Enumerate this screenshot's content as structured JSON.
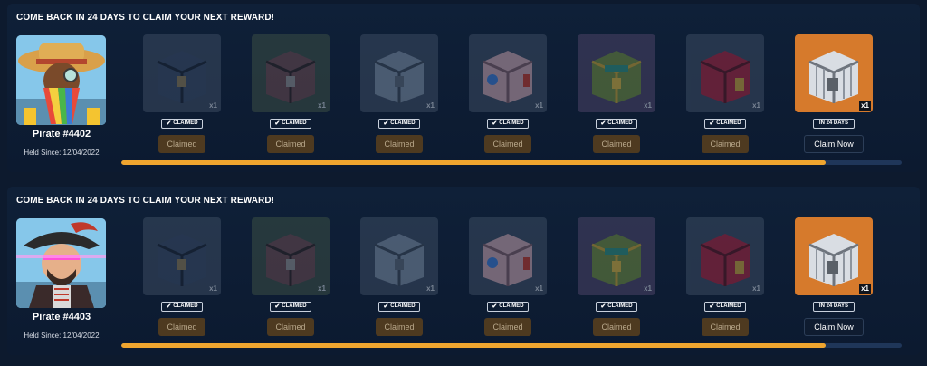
{
  "panels": [
    {
      "title": "COME BACK IN 24 DAYS TO CLAIM YOUR NEXT REWARD!",
      "pirate_name": "Pirate #4402",
      "held_since": "Held Since: 12/04/2022",
      "avatar": "pirate-avatar-straw-hat",
      "progress_fraction": 0.902,
      "rewards": [
        {
          "quantity": "x1",
          "status": "CLAIMED",
          "button": "Claimed",
          "bg": "#3b4a60",
          "chest_color": "#3a4b66",
          "claimed": true
        },
        {
          "quantity": "x1",
          "status": "CLAIMED",
          "button": "Claimed",
          "bg": "#3b4e44",
          "chest_color": "#6b4a4f",
          "claimed": true
        },
        {
          "quantity": "x1",
          "status": "CLAIMED",
          "button": "Claimed",
          "bg": "#3b4a60",
          "chest_color": "#7c8ea3",
          "claimed": true
        },
        {
          "quantity": "x1",
          "status": "CLAIMED",
          "button": "Claimed",
          "bg": "#3b4a60",
          "chest_color": "#c9a3ad",
          "claimed": true
        },
        {
          "quantity": "x1",
          "status": "CLAIMED",
          "button": "Claimed",
          "bg": "#4b4366",
          "chest_color": "#6f8a3e",
          "claimed": true
        },
        {
          "quantity": "x1",
          "status": "CLAIMED",
          "button": "Claimed",
          "bg": "#3b4a60",
          "chest_color": "#a8253e",
          "claimed": true
        },
        {
          "quantity": "x1",
          "status": "IN 24 DAYS",
          "button": "Claim Now",
          "bg": "#d67a2c",
          "chest_color": "#d9dde3",
          "claimed": false
        }
      ]
    },
    {
      "title": "COME BACK IN 24 DAYS TO CLAIM YOUR NEXT REWARD!",
      "pirate_name": "Pirate #4403",
      "held_since": "Held Since: 12/04/2022",
      "avatar": "pirate-avatar-laser-eyes",
      "progress_fraction": 0.902,
      "rewards": [
        {
          "quantity": "x1",
          "status": "CLAIMED",
          "button": "Claimed",
          "bg": "#3b4a60",
          "chest_color": "#3a4b66",
          "claimed": true
        },
        {
          "quantity": "x1",
          "status": "CLAIMED",
          "button": "Claimed",
          "bg": "#3b4e44",
          "chest_color": "#6b4a4f",
          "claimed": true
        },
        {
          "quantity": "x1",
          "status": "CLAIMED",
          "button": "Claimed",
          "bg": "#3b4a60",
          "chest_color": "#7c8ea3",
          "claimed": true
        },
        {
          "quantity": "x1",
          "status": "CLAIMED",
          "button": "Claimed",
          "bg": "#3b4a60",
          "chest_color": "#c9a3ad",
          "claimed": true
        },
        {
          "quantity": "x1",
          "status": "CLAIMED",
          "button": "Claimed",
          "bg": "#4b4366",
          "chest_color": "#6f8a3e",
          "claimed": true
        },
        {
          "quantity": "x1",
          "status": "CLAIMED",
          "button": "Claimed",
          "bg": "#3b4a60",
          "chest_color": "#a8253e",
          "claimed": true
        },
        {
          "quantity": "x1",
          "status": "IN 24 DAYS",
          "button": "Claim Now",
          "bg": "#d67a2c",
          "chest_color": "#d9dde3",
          "claimed": false
        }
      ]
    }
  ],
  "colors": {
    "accent": "#efa52f",
    "track": "#1f3659",
    "claimed_button": "#4e3a20"
  }
}
